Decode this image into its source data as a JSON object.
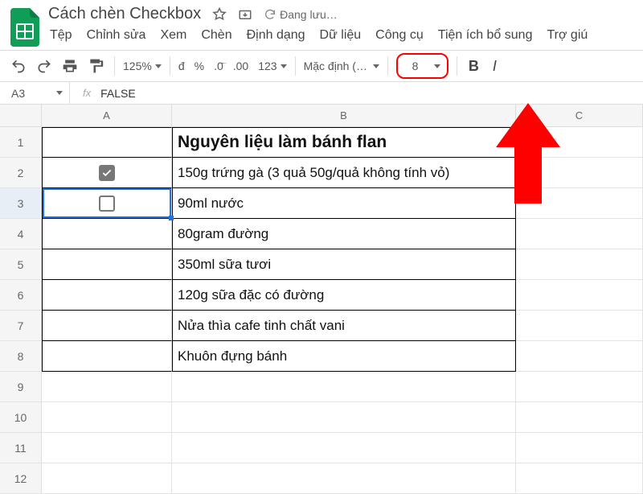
{
  "doc": {
    "title": "Cách chèn Checkbox"
  },
  "status": {
    "saving": "Đang lưu…"
  },
  "menu": {
    "file": "Tệp",
    "edit": "Chỉnh sửa",
    "view": "Xem",
    "insert": "Chèn",
    "format": "Định dạng",
    "data": "Dữ liệu",
    "tools": "Công cụ",
    "addons": "Tiện ích bổ sung",
    "help": "Trợ giú"
  },
  "toolbar": {
    "zoom": "125%",
    "currency": "đ",
    "percent": "%",
    "dec_less": ".0",
    "dec_more": ".00",
    "num_fmt": "123",
    "font_name": "Mặc định ( …",
    "font_size": "8",
    "bold": "B",
    "italic": "I"
  },
  "namebox": "A3",
  "fx_label": "fx",
  "formula_value": "FALSE",
  "columns": {
    "A": "A",
    "B": "B",
    "C": "C"
  },
  "rows": [
    "1",
    "2",
    "3",
    "4",
    "5",
    "6",
    "7",
    "8",
    "9",
    "10",
    "11",
    "12"
  ],
  "cells": {
    "B1": "Nguyên liệu làm bánh flan",
    "B2": "150g trứng gà (3 quả 50g/quả không tính vỏ)",
    "B3": "90ml nước",
    "B4": "80gram đường",
    "B5": "350ml sữa tươi",
    "B6": "120g sữa đặc có đường",
    "B7": "Nửa thìa cafe tinh chất vani",
    "B8": "Khuôn đựng bánh"
  },
  "checkboxes": {
    "A2": true,
    "A3": false
  }
}
